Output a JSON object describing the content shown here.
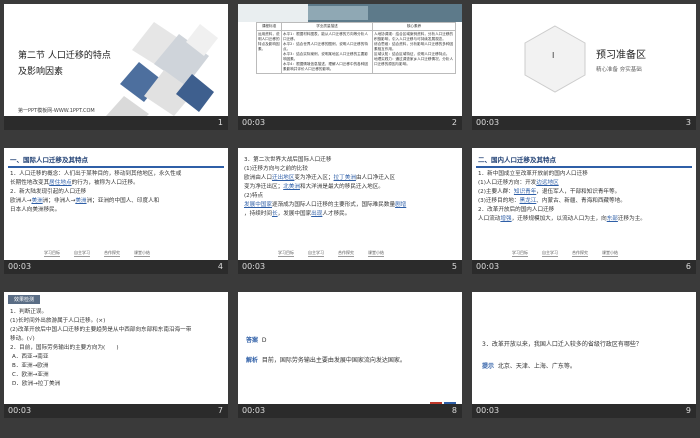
{
  "slides": [
    {
      "num": "1",
      "time": "",
      "title1": "第二节 人口迁移的特点",
      "title2": "及影响因素",
      "footer": "第一PPT模板网-WWW.1PPT.COM"
    },
    {
      "num": "2",
      "time": "00:03",
      "headers": [
        "课程标准",
        "学业质量描述",
        "核心素养"
      ],
      "col1": "运用资料，说明人口迁移的特点及影响因素。",
      "col2": [
        "水平1：根据材料图表，能从人口迁移的方向等分析人口迁移。",
        "水平2：结合世界人口迁移的图例，说明人口迁移的特点。",
        "水平3：结合实际案例，说明某地区人口迁移的主要影响因素。",
        "水平4：根据情境信息描述，理解人口迁移中的各种因素影响并评价人口迁移的影响。"
      ],
      "col3": [
        "人地协调观：结合区域案例资料，分析人口迁移的积极影响，引入人口迁移与可持续发展观念。",
        "综合思维：结合资料，分析影响人口迁移的多种因素相互作用。",
        "区域认知：结合区域特征，说明人口迁移特点。",
        "地理实践力：通过调查家乡人口迁移情况，分析人口迁移的原因与影响。"
      ]
    },
    {
      "num": "3",
      "time": "00:03",
      "badge": "I",
      "title": "预习准备区",
      "subtitle": "精心准备 夯实基础"
    },
    {
      "num": "4",
      "time": "00:03",
      "heading": "一、国际人口迁移及其特点",
      "l1": "1．人口迁移的概念：人们出于某种目的，移动到其他地区，永久性或",
      "l2a": "长期性地改变其",
      "l2b": "居住地点",
      "l2c": "的行为，被称为人口迁移。",
      "l3": "2．新大陆发现引起的人口迁移",
      "l4a": "欧洲人→",
      "l4b": "美洲",
      "l4c": "洲；非洲人→",
      "l4d": "美洲",
      "l4e": "洲；亚洲的中国人、印度人和",
      "l5": "日本人向美洲移民。"
    },
    {
      "num": "5",
      "time": "00:03",
      "l1": "3．第二次世界大战后国际人口迁移",
      "l2": "(1)迁移方向与之前的比较",
      "l3a": "欧洲由人口",
      "l3b": "迁出地区",
      "l3c": "变为净迁入区；",
      "l3d": "拉丁美洲",
      "l3e": "由人口净迁入区",
      "l4a": "变为净迁出区；",
      "l4b": "北美洲",
      "l4c": "和大洋洲是最大的移民迁入地区。",
      "l5": "(2)特点",
      "l6a": "",
      "l6b": "发展中国家",
      "l6c": "逐渐成为国际人口迁移的主要形式，国际难民数量",
      "l6d": "剧增",
      "l7a": "，持续时间",
      "l7b": "长",
      "l7c": "，发展中国家",
      "l7d": "出现",
      "l7e": "人才移民。"
    },
    {
      "num": "6",
      "time": "00:03",
      "heading": "二、国内人口迁移及其特点",
      "l1": "1．新中国成立至改革开放前的国内人口迁移",
      "l2a": "(1)人口迁移方向：开发",
      "l2b": "边远地区",
      "l2c": "",
      "l3a": "(2)主要人群：",
      "l3b": "知识青年",
      "l3c": "，退伍军人，干部和知识青年等。",
      "l4a": "(3)迁移目的地：",
      "l4b": "黑龙江",
      "l4c": "、内蒙古、新疆、青海和西藏等地。",
      "l5": "2．改革开放后的国内人口迁移",
      "l6a": "人口流动",
      "l6b": "增强",
      "l6c": "，迁移规模加大，以流动人口为主，向",
      "l6d": "东部",
      "l6e": "迁移为主。"
    },
    {
      "num": "7",
      "time": "00:03",
      "tag": "效果检测",
      "l1": "1．判断正误。",
      "l2": "(1)长时间外出旅游属于人口迁移。(×)",
      "l3": "(2)改革开放后中国人口迁移的主要趋势是从中西部向东部和东南沿海一带",
      "l4": "移动。(√)",
      "l5": "2．目前，国际劳务输出的主要方向为(　　)",
      "opts": [
        "A．西亚→南亚",
        "B．亚洲→欧洲",
        "C．欧洲→亚洲",
        "D．欧洲→拉丁美洲"
      ]
    },
    {
      "num": "8",
      "time": "00:03",
      "ans_label": "答案",
      "ans": "D",
      "exp_label": "解析",
      "exp": "目前，国际劳务输出主要由发展中国家流向发达国家。"
    },
    {
      "num": "9",
      "time": "00:03",
      "q": "3．改革开放以来，我国人口迁入较多的省级行政区有哪些？",
      "hint_label": "提示",
      "hint": "北京、天津、上海、广东等。"
    }
  ],
  "nav": [
    "学习目标",
    "自主学习",
    "合作探究",
    "课堂小结",
    "课后作业"
  ]
}
